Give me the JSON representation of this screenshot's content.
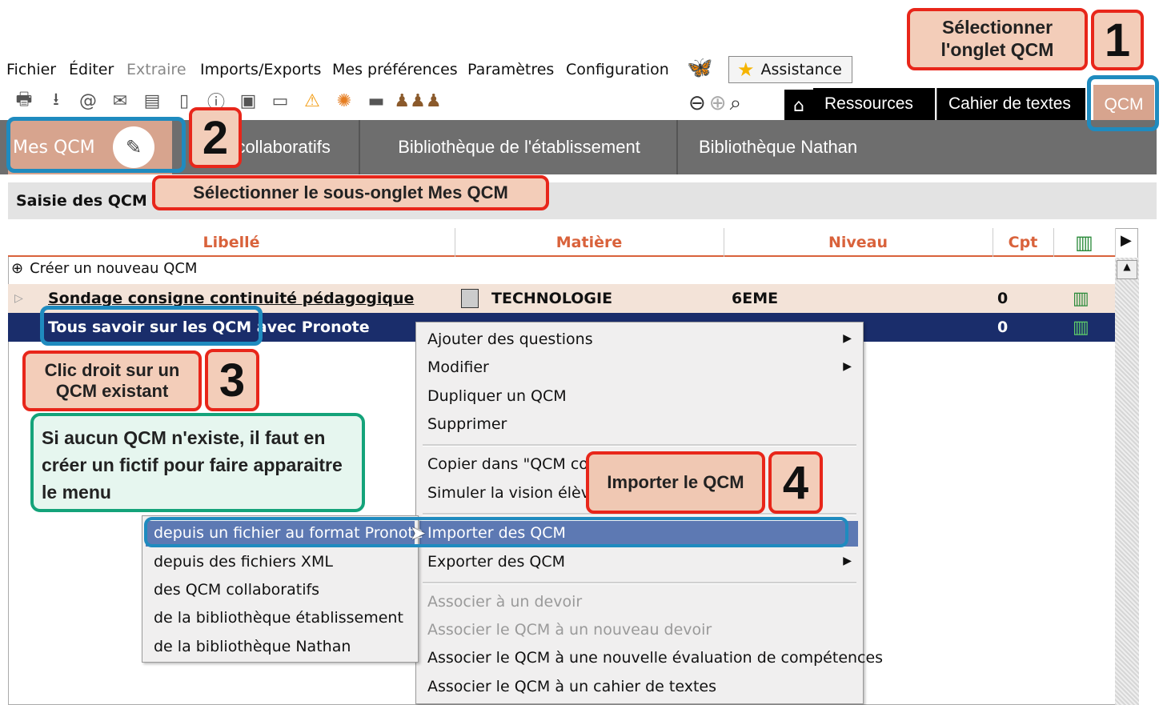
{
  "menu": [
    "Fichier",
    "Éditer",
    "Extraire",
    "Imports/Exports",
    "Mes préférences",
    "Paramètres",
    "Configuration"
  ],
  "assistance_label": "Assistance",
  "nav_tabs": [
    "Ressources",
    "Cahier de textes",
    "QCM"
  ],
  "sub_tabs": {
    "mes_qcm": "Mes QCM",
    "collab": "QCM collaboratifs",
    "bib_etab": "Bibliothèque de l'établissement",
    "bib_nathan": "Bibliothèque Nathan"
  },
  "section_title": "Saisie des QCM",
  "columns": {
    "libelle": "Libellé",
    "matiere": "Matière",
    "niveau": "Niveau",
    "cpt": "Cpt"
  },
  "create_row": "Créer un nouveau QCM",
  "rows": [
    {
      "libelle": "Sondage consigne continuité pédagogique",
      "matiere": "TECHNOLOGIE",
      "niveau": "6EME",
      "cpt": "0"
    },
    {
      "libelle": "Tous savoir sur les QCM avec Pronote",
      "matiere": "",
      "niveau": "",
      "cpt": "0"
    }
  ],
  "context_menu": {
    "ajouter": "Ajouter des questions",
    "modifier": "Modifier",
    "dupliquer": "Dupliquer un QCM",
    "supprimer": "Supprimer",
    "copier": "Copier dans \"QCM collaboratifs\"",
    "simuler": "Simuler la vision élève",
    "importer": "Importer des QCM",
    "exporter": "Exporter des QCM",
    "assoc_devoir": "Associer à un devoir",
    "assoc_nouveau_devoir": "Associer le QCM à un nouveau devoir",
    "assoc_eval": "Associer le QCM à une nouvelle évaluation de compétences",
    "assoc_cahier": "Associer le QCM à un cahier de textes"
  },
  "submenu": [
    "depuis un fichier au format Pronote",
    "depuis des fichiers XML",
    "des QCM collaboratifs",
    "de la bibliothèque établissement",
    "de la bibliothèque Nathan"
  ],
  "callouts": {
    "c1": "Sélectionner l'onglet QCM",
    "c2": "Sélectionner le sous-onglet Mes QCM",
    "c3": "Clic droit sur un QCM existant",
    "c4": "Importer le QCM",
    "note": "Si aucun QCM n'existe, il faut en créer un fictif pour faire apparaitre le menu",
    "n1": "1",
    "n2": "2",
    "n3": "3",
    "n4": "4"
  },
  "colors": {
    "accent": "#d9623b",
    "selection": "#1a2d6b",
    "callout_border": "#e8261a",
    "highlight_frame": "#1f8bbf",
    "note_border": "#14a37a"
  }
}
